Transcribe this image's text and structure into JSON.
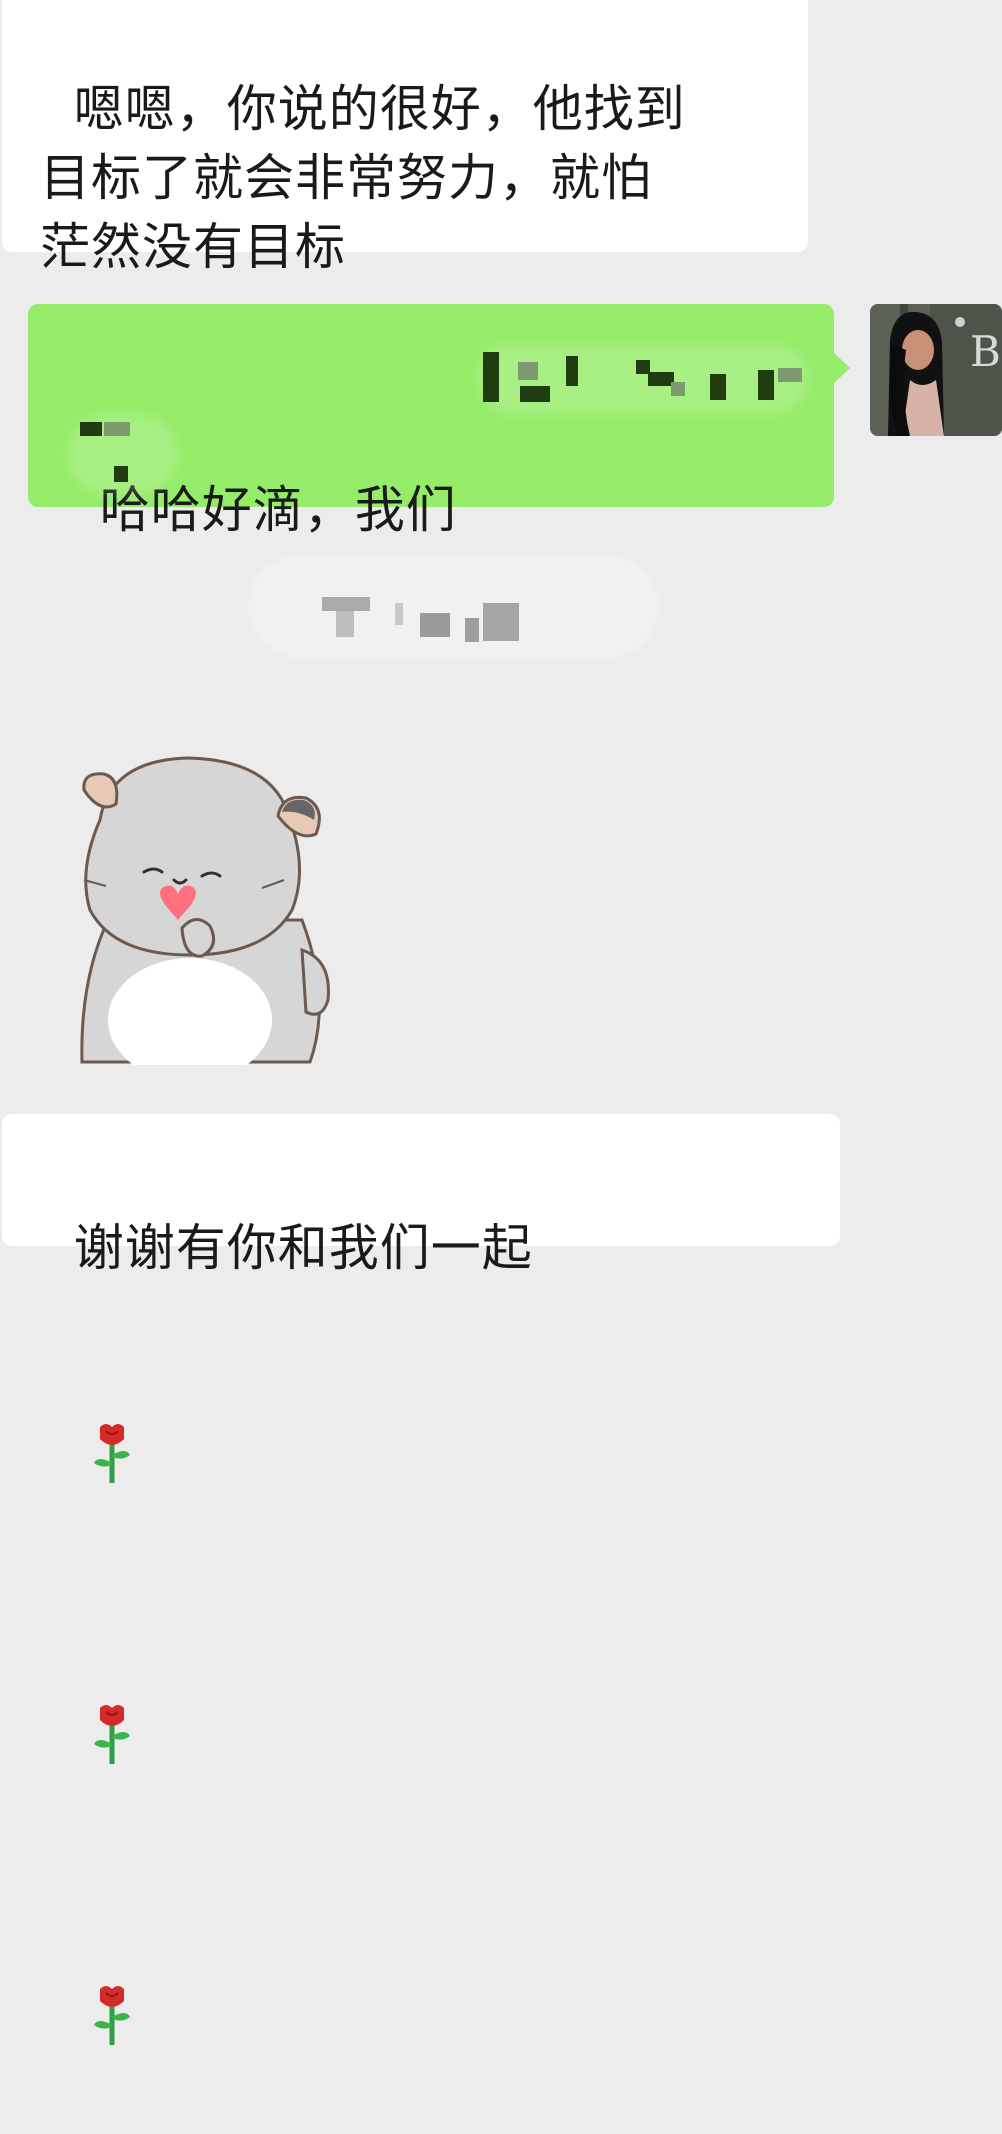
{
  "messages": [
    {
      "id": "msg1",
      "side": "left",
      "text": "嗯嗯，你说的很好，他找到\n目标了就会非常努力，就怕\n茫然没有目标"
    },
    {
      "id": "msg2",
      "side": "right",
      "text_visible": "哈哈好滴，我们",
      "redacted": true
    },
    {
      "id": "msg3",
      "type": "sticker",
      "sticker_icon": "hamster-sticker-heart-icon"
    },
    {
      "id": "msg4",
      "side": "left",
      "text": "谢谢有你和我们一起",
      "emoji_icons": [
        "rose-icon",
        "rose-icon",
        "rose-icon"
      ]
    }
  ],
  "system_notice": {
    "redacted": true
  },
  "avatar": {
    "icon": "user-avatar-icon"
  },
  "colors": {
    "background": "#ececec",
    "incoming_bubble": "#ffffff",
    "outgoing_bubble": "#95ec69"
  }
}
